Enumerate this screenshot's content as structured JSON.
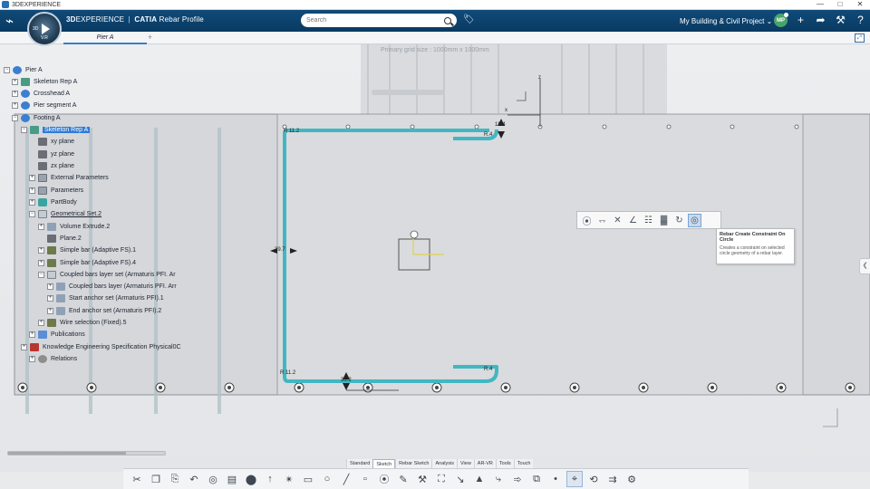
{
  "window": {
    "title": "3DEXPERIENCE",
    "controls": [
      "—",
      "□",
      "✕"
    ]
  },
  "topbar": {
    "brand_3d": "3D",
    "brand_experience": "EXPERIENCE",
    "brand_sep": "|",
    "brand_app": "CATIA",
    "brand_role": "Rebar Profile",
    "compass_version": "V.R",
    "compass_left": "3D",
    "search_placeholder": "Search",
    "workspace": "My Building & Civil Project ⌄",
    "avatar_initials": "MP",
    "icons": [
      "plus-icon",
      "share-icon",
      "tools-icon",
      "help-icon"
    ]
  },
  "tabs": {
    "active": "Pier A",
    "add": "+"
  },
  "canvas": {
    "grid_hint": "Primary grid size : 1000mm x 1000mm"
  },
  "tree": {
    "items": [
      {
        "label": "Pier A",
        "icon": "prod",
        "exp": "−",
        "selected": false
      },
      {
        "label": "Skeleton Rep A",
        "icon": "part",
        "exp": "+",
        "selected": false
      },
      {
        "label": "Crosshead A",
        "icon": "prod",
        "exp": "+",
        "selected": false
      },
      {
        "label": "Pier segment A",
        "icon": "prod",
        "exp": "+",
        "selected": false
      },
      {
        "label": "Footing A",
        "icon": "prod",
        "exp": "−",
        "selected": false
      },
      {
        "label": "Skeleton Rep A",
        "icon": "part",
        "exp": "−",
        "selected": true
      },
      {
        "label": "xy plane",
        "icon": "plane",
        "exp": "",
        "selected": false
      },
      {
        "label": "yz plane",
        "icon": "plane",
        "exp": "",
        "selected": false
      },
      {
        "label": "zx plane",
        "icon": "plane",
        "exp": "",
        "selected": false
      },
      {
        "label": "External Parameters",
        "icon": "param",
        "exp": "+",
        "selected": false
      },
      {
        "label": "Parameters",
        "icon": "param",
        "exp": "+",
        "selected": false
      },
      {
        "label": "PartBody",
        "icon": "body",
        "exp": "+",
        "selected": false
      },
      {
        "label": "Geometrical Set.2",
        "icon": "geoset",
        "exp": "−",
        "selected": false
      },
      {
        "label": "Volume Extrude.2",
        "icon": "feat",
        "exp": "+",
        "selected": false
      },
      {
        "label": "Plane.2",
        "icon": "plane",
        "exp": "",
        "selected": false
      },
      {
        "label": "Simple bar (Adaptive FS).1",
        "icon": "bar",
        "exp": "+",
        "selected": false
      },
      {
        "label": "Simple bar (Adaptive FS).4",
        "icon": "bar",
        "exp": "+",
        "selected": false
      },
      {
        "label": "Coupled bars layer set (Armaturis PFI. Ar",
        "icon": "geoset",
        "exp": "−",
        "selected": false
      },
      {
        "label": "Coupled bars layer (Armaturis PFI. Arr",
        "icon": "feat",
        "exp": "+",
        "selected": false
      },
      {
        "label": "Start anchor set (Armaturis PFI).1",
        "icon": "feat",
        "exp": "+",
        "selected": false
      },
      {
        "label": "End anchor set (Armaturis PFI).2",
        "icon": "feat",
        "exp": "+",
        "selected": false
      },
      {
        "label": "Wire selection (Fixed).5",
        "icon": "bar",
        "exp": "+",
        "selected": false
      },
      {
        "label": "Publications",
        "icon": "pub",
        "exp": "+",
        "selected": false
      },
      {
        "label": "Knowledge Engineering Specification Physical0C",
        "icon": "kwe",
        "exp": "+",
        "selected": false
      },
      {
        "label": "Relations",
        "icon": "rel",
        "exp": "+",
        "selected": false
      }
    ]
  },
  "sketch": {
    "labels": {
      "r_top_left": "R 11.2",
      "r_top_right": "R.4",
      "r_top_dim": "18.4",
      "r_bottom_left": "R 11.2",
      "r_bottom_right": "R.4",
      "dim_left": "39.7",
      "dim_bottom": "33.2",
      "axis_x": "x",
      "axis_z": "z"
    }
  },
  "context_toolbar": {
    "tools": [
      "constraint-icon",
      "rebar-align-icon",
      "cross-icon",
      "angle-icon",
      "rebar-copy-icon",
      "rebar-bend-icon",
      "rebar-rotate-icon",
      "rebar-circle-constraint-icon"
    ],
    "tooltip_title": "Rebar Create Constraint On Circle",
    "tooltip_desc": "Creates a constraint on selected circle geometry of a rebar layer."
  },
  "action_bar": {
    "tabs": [
      "Standard",
      "Sketch",
      "Rebar Sketch",
      "Analysis",
      "View",
      "AR-VR",
      "Tools",
      "Touch"
    ],
    "active_tab": "Sketch",
    "glyphs": [
      "✂",
      "❐",
      "⎘",
      "↶",
      "◎",
      "▤",
      "⬤",
      "↑",
      "✴",
      "▭",
      "○",
      "╱",
      "▫",
      "⦿",
      "✎",
      "⚒",
      "⛶",
      "↘",
      "▲",
      "⤷",
      "➾",
      "⧉",
      "•",
      "⌖",
      "⟲",
      "⇉",
      "⚙"
    ]
  },
  "colors": {
    "rebar": "#41b7c2",
    "selection": "#2f7bd6",
    "topbar": "#0f4a7a"
  }
}
